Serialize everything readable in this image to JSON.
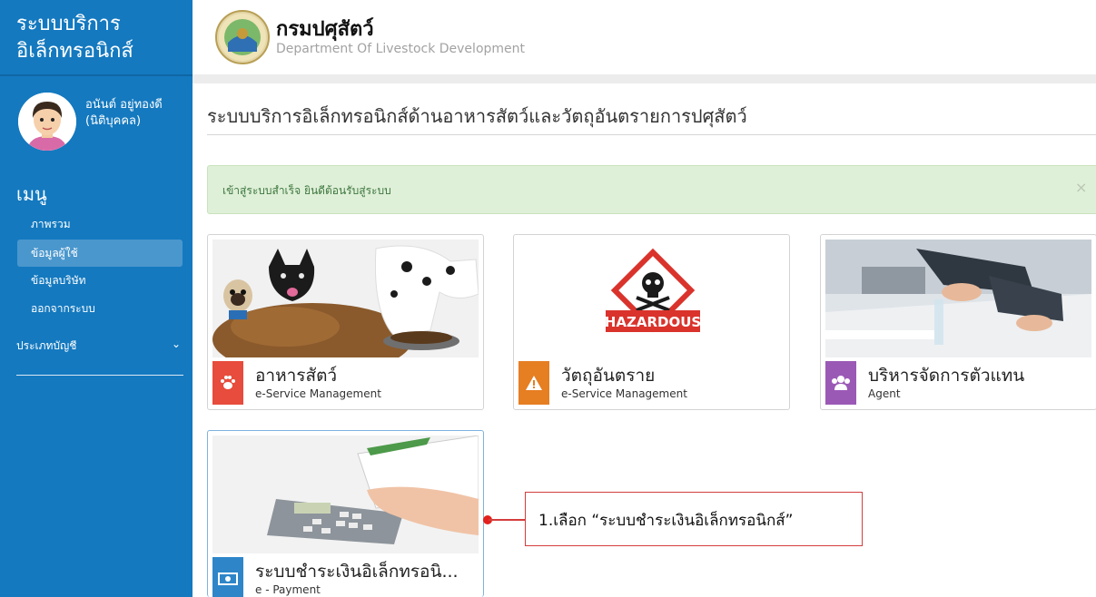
{
  "sidebar": {
    "brand_line1": "ระบบบริการ",
    "brand_line2": "อิเล็กทรอนิกส์",
    "user_name": "อนันต์ อยู่ทองดี",
    "user_type": "(นิติบุคคล)",
    "menu_title": "เมนู",
    "menu_items": [
      "ภาพรวม",
      "ข้อมูลผู้ใช้",
      "ข้อมูลบริษัท",
      "ออกจากระบบ"
    ],
    "active_item": "ข้อมูลผู้ใช้",
    "category_label": "ประเภทบัญชี",
    "category_chevron": "⌄"
  },
  "header": {
    "dept_th": "กรมปศุสัตว์",
    "dept_en": "Department Of Livestock Development"
  },
  "main": {
    "page_title": "ระบบบริการอิเล็กทรอนิกส์ด้านอาหารสัตว์และวัตถุอันตรายการปศุสัตว์",
    "alert_text": "เข้าสู่ระบบสำเร็จ ยินดีต้อนรับสู่ระบบ",
    "alert_close": "×",
    "cards": [
      {
        "title": "อาหารสัตว์",
        "subtitle": "e-Service Management",
        "icon": "paw-icon",
        "color": "#e74c3c"
      },
      {
        "title": "วัตถุอันตราย",
        "subtitle": "e-Service Management",
        "icon": "warning-icon",
        "color": "#e67e22"
      },
      {
        "title": "บริหารจัดการตัวแทน",
        "subtitle": "Agent",
        "icon": "users-icon",
        "color": "#9b59b6"
      },
      {
        "title": "ระบบชำระเงินอิเล็กทรอนิ...",
        "subtitle": "e - Payment",
        "icon": "money-icon",
        "color": "#2e86c9"
      }
    ],
    "hazard_label": "HAZARDOUS"
  },
  "annotation": {
    "callout_text": "1.เลือก “ระบบชำระเงินอิเล็กทรอนิกส์”",
    "color": "#d43d3d"
  }
}
